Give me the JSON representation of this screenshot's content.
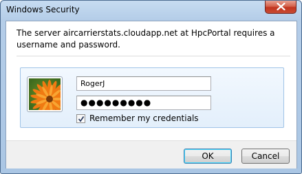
{
  "window": {
    "title": "Windows Security",
    "close_icon": "close-icon"
  },
  "message": "The server aircarrierstats.cloudapp.net at HpcPortal requires a username and password.",
  "credentials": {
    "avatar_icon": "user-tile-flower-icon",
    "username_value": "RogerJ",
    "password_value": "●●●●●●●●●",
    "remember_checked": true,
    "remember_label": "Remember my credentials"
  },
  "buttons": {
    "ok_label": "OK",
    "cancel_label": "Cancel"
  },
  "colors": {
    "title_bar": "#b4cde8",
    "close_button": "#c2341f",
    "panel_border": "#9fc3e7"
  }
}
